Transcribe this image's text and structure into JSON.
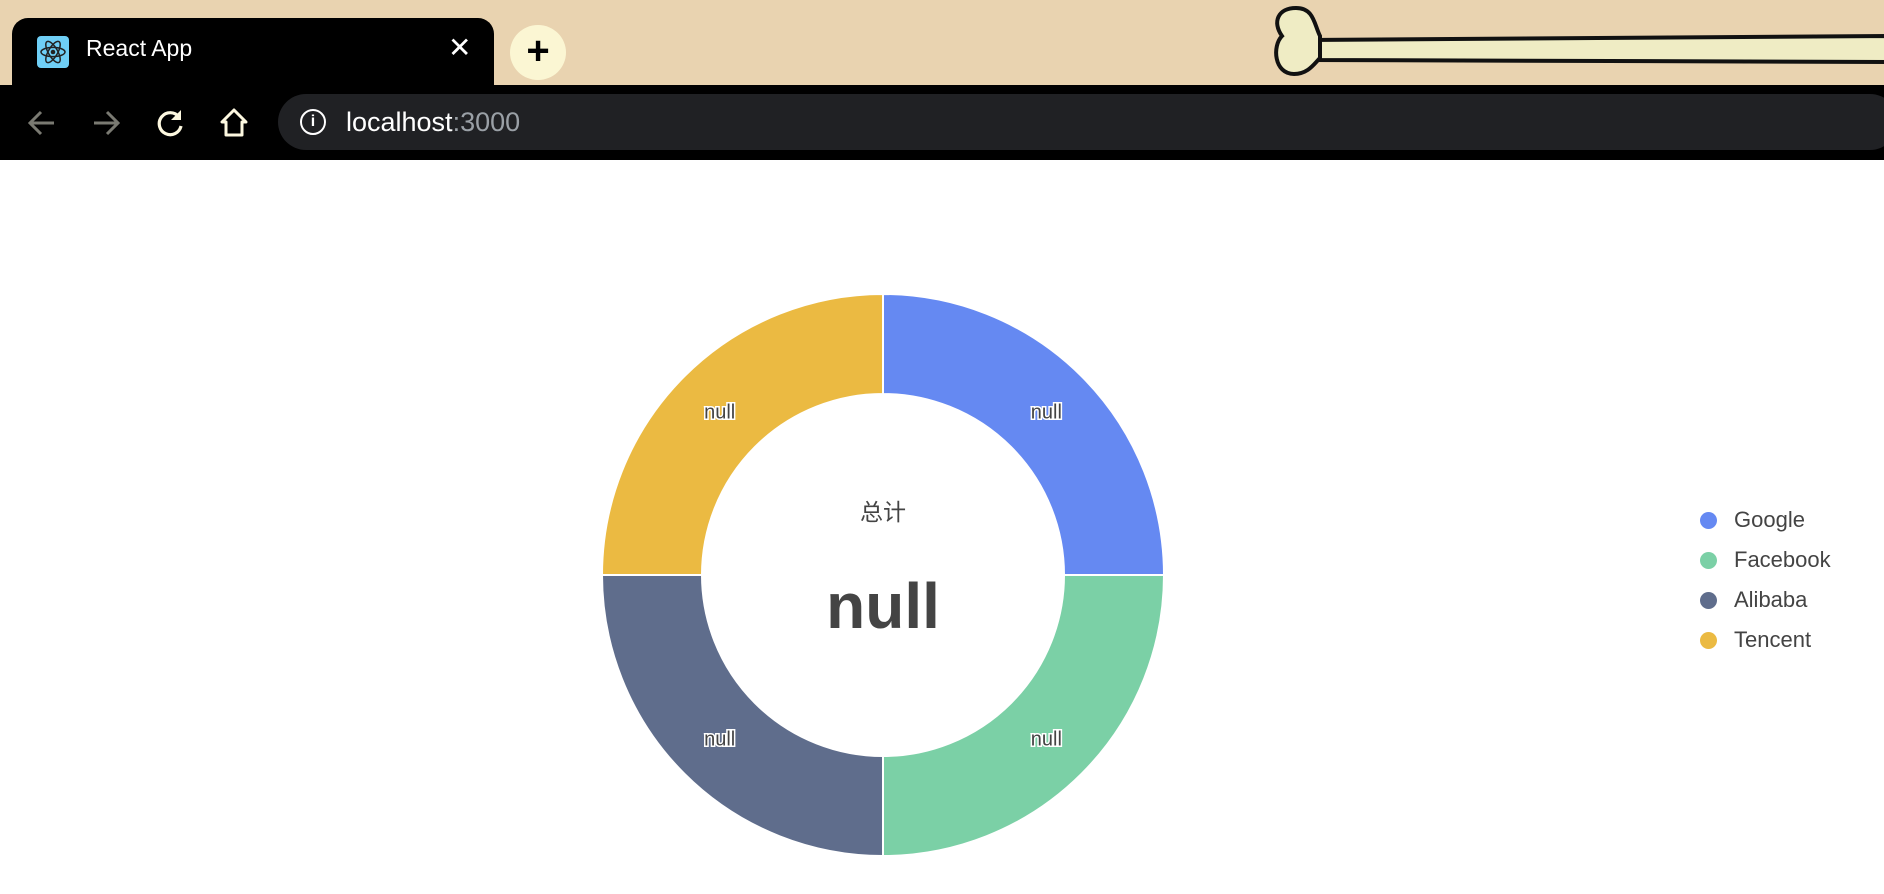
{
  "browser": {
    "tab_title": "React App",
    "tab_close": "✕",
    "new_tab": "+",
    "url_host": "localhost",
    "url_port": ":3000",
    "info_icon": "i"
  },
  "chart_data": {
    "type": "pie",
    "variant": "donut",
    "categories": [
      "Google",
      "Facebook",
      "Alibaba",
      "Tencent"
    ],
    "values": [
      null,
      null,
      null,
      null
    ],
    "slice_labels": [
      "null",
      "null",
      "null",
      "null"
    ],
    "colors": [
      "#6589f2",
      "#7bd0a6",
      "#5f6d8c",
      "#ebba42"
    ],
    "center_title": "总计",
    "center_value": "null",
    "legend_position": "right",
    "legend": [
      "Google",
      "Facebook",
      "Alibaba",
      "Tencent"
    ]
  }
}
